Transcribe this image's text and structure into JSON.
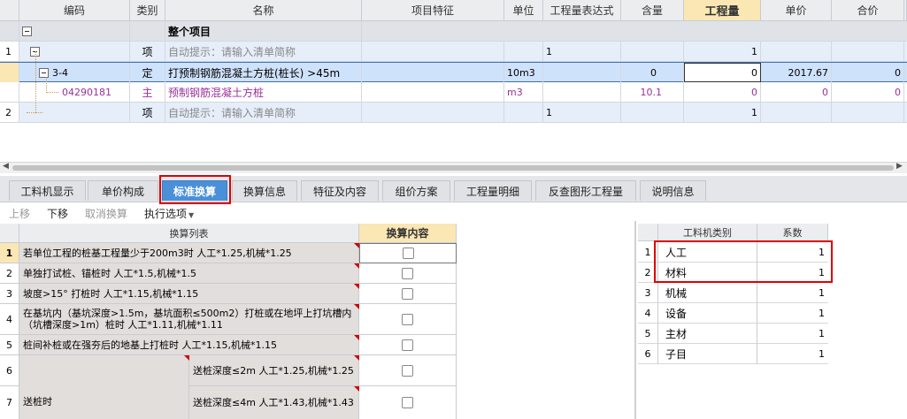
{
  "top_grid": {
    "headers": {
      "code": "编码",
      "category": "类别",
      "name": "名称",
      "feature": "项目特征",
      "unit": "单位",
      "expr": "工程量表达式",
      "content": "含量",
      "qty": "工程量",
      "price": "单价",
      "total": "合价"
    },
    "rows": [
      {
        "num": "",
        "code": "",
        "category": "",
        "name": "整个项目",
        "unit": "",
        "expr": "",
        "content": "",
        "qty": "",
        "price": "",
        "total": ""
      },
      {
        "num": "1",
        "code": "",
        "category": "项",
        "name": "自动提示：请输入清单简称",
        "unit": "",
        "expr": "1",
        "content": "",
        "qty": "1",
        "price": "",
        "total": ""
      },
      {
        "num": "",
        "code": "3-4",
        "category": "定",
        "name": "打预制钢筋混凝土方桩(桩长) >45m",
        "unit": "10m3",
        "expr": "",
        "content": "0",
        "qty": "0",
        "price": "2017.67",
        "total": "0"
      },
      {
        "num": "",
        "code": "04290181",
        "category": "主",
        "name": "预制钢筋混凝土方桩",
        "unit": "m3",
        "expr": "",
        "content": "10.1",
        "qty": "0",
        "price": "0",
        "total": "0"
      },
      {
        "num": "2",
        "code": "",
        "category": "项",
        "name": "自动提示：请输入清单简称",
        "unit": "",
        "expr": "1",
        "content": "",
        "qty": "1",
        "price": "",
        "total": ""
      }
    ]
  },
  "tabs": [
    "工料机显示",
    "单价构成",
    "标准换算",
    "换算信息",
    "特征及内容",
    "组价方案",
    "工程量明细",
    "反查图形工程量",
    "说明信息"
  ],
  "active_tab": "标准换算",
  "toolbar": {
    "up": "上移",
    "down": "下移",
    "cancel": "取消换算",
    "options": "执行选项"
  },
  "conv_grid": {
    "headers": {
      "list": "换算列表",
      "content": "换算内容"
    },
    "rows": [
      {
        "num": "1",
        "text": "若单位工程的桩基工程量少于200m3时 人工*1.25,机械*1.25"
      },
      {
        "num": "2",
        "text": "单独打试桩、锚桩时 人工*1.5,机械*1.5"
      },
      {
        "num": "3",
        "text": "坡度>15° 打桩时 人工*1.15,机械*1.15"
      },
      {
        "num": "4",
        "text": "在基坑内（基坑深度>1.5m，基坑面积≤500m2）打桩或在地坪上打坑槽内（坑槽深度>1m）桩时 人工*1.11,机械*1.11"
      },
      {
        "num": "5",
        "text": "桩间补桩或在强夯后的地基上打桩时 人工*1.15,机械*1.15"
      },
      {
        "num": "6",
        "text": "送桩深度≤2m 人工*1.25,机械*1.25"
      },
      {
        "num": "7",
        "text": "送桩深度≤4m 人工*1.43,机械*1.43"
      }
    ],
    "group_label": "送桩时"
  },
  "coef_grid": {
    "headers": {
      "type": "工料机类别",
      "coef": "系数"
    },
    "rows": [
      {
        "num": "1",
        "type": "人工",
        "coef": "1"
      },
      {
        "num": "2",
        "type": "材料",
        "coef": "1"
      },
      {
        "num": "3",
        "type": "机械",
        "coef": "1"
      },
      {
        "num": "4",
        "type": "设备",
        "coef": "1"
      },
      {
        "num": "5",
        "type": "主材",
        "coef": "1"
      },
      {
        "num": "6",
        "type": "子目",
        "coef": "1"
      }
    ]
  },
  "colors": {
    "selected_row": "#cfe2fb",
    "highlight_row": "#e6eefa",
    "accent": "#4a90d9",
    "purple_text": "#9b2f9b"
  }
}
